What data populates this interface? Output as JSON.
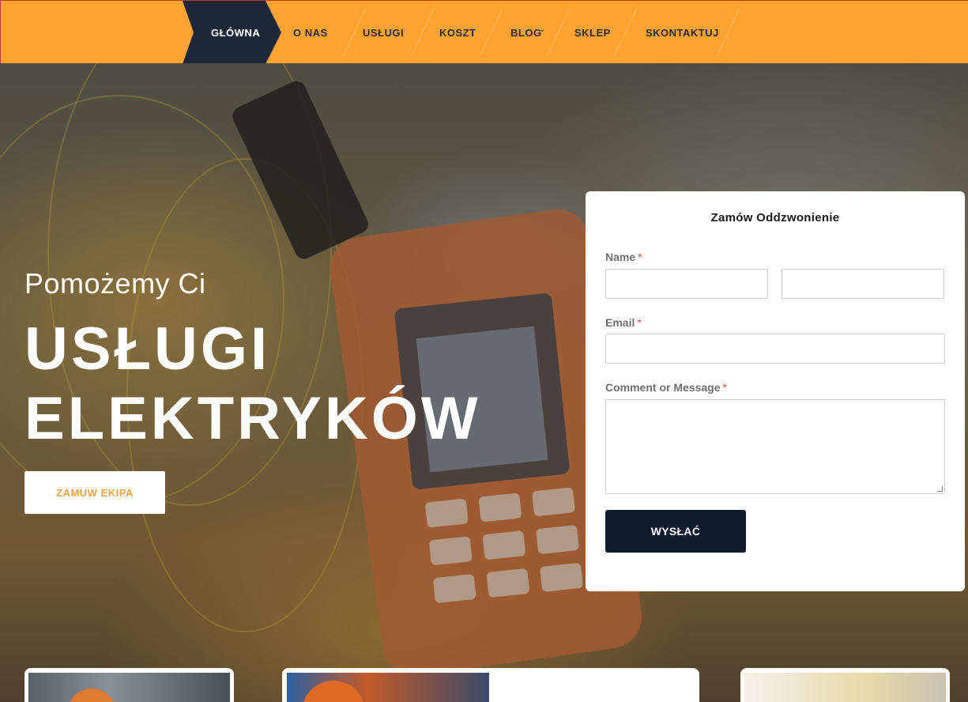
{
  "nav": {
    "items": [
      {
        "label": "GŁÓWNA",
        "active": true
      },
      {
        "label": "O NAS"
      },
      {
        "label": "USŁUGI"
      },
      {
        "label": "KOSZT"
      },
      {
        "label": "BLOG",
        "has_dropdown": true,
        "icon": "chevron-down-icon"
      },
      {
        "label": "SKLEP"
      },
      {
        "label": "SKONTAKTUJ"
      }
    ]
  },
  "hero": {
    "subtitle": "Pomożemy Ci",
    "title_line1": "USŁUGI",
    "title_line2": "ELEKTRYKÓW",
    "cta_label": "ZAMUW EKIPA"
  },
  "form": {
    "title": "Zamów Oddzwonienie",
    "name_label": "Name",
    "email_label": "Email",
    "message_label": "Comment or Message",
    "required_mark": "*",
    "name_first_value": "",
    "name_last_value": "",
    "email_value": "",
    "message_value": "",
    "submit_label": "WYSŁAĆ"
  },
  "colors": {
    "nav_bg": "#ffa22e",
    "nav_active_bg": "#1c2738",
    "accent_text": "#f2a34a",
    "submit_bg": "#0e1a2e",
    "required": "#d9534f"
  }
}
